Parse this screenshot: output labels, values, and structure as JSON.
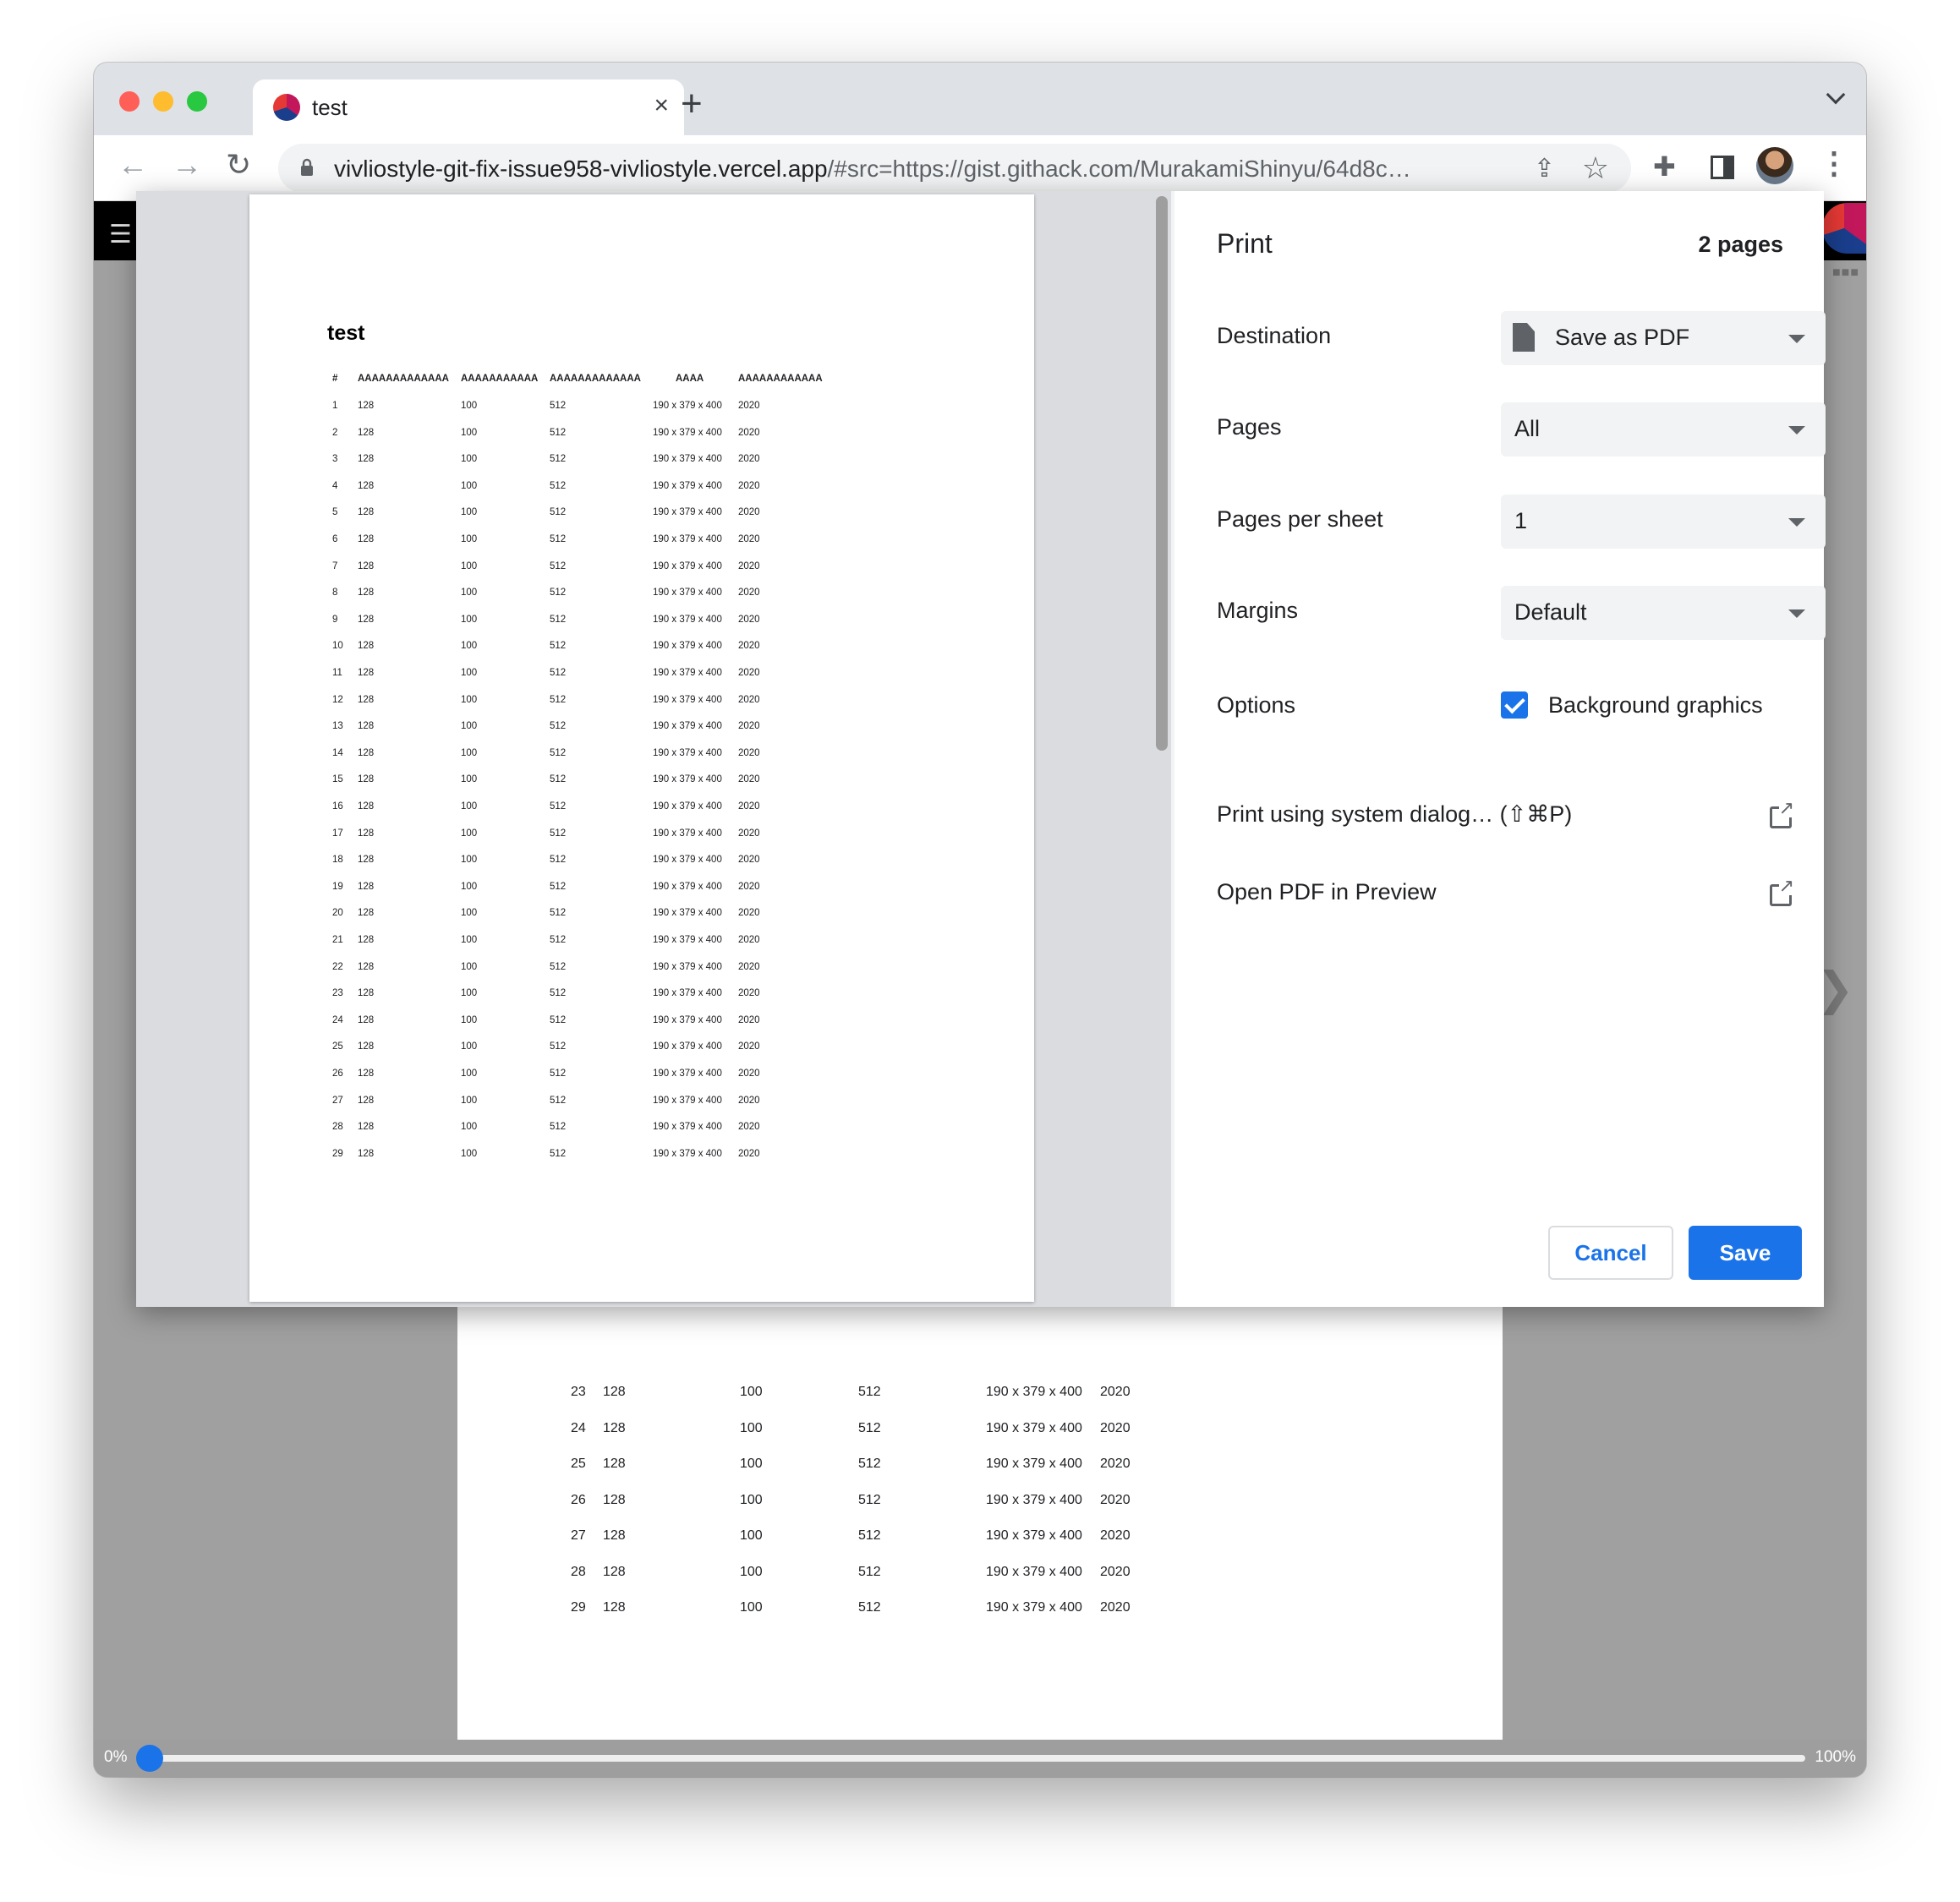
{
  "browser": {
    "tab_title": "test",
    "tab_close": "×",
    "new_tab": "+",
    "url_host": "vivliostyle-git-fix-issue958-vivliostyle.vercel.app",
    "url_rest": "/#src=https://gist.githack.com/MurakamiShinyu/64d8c…",
    "icons": [
      "back-arrow-icon",
      "forward-arrow-icon",
      "reload-icon",
      "lock-icon",
      "share-icon",
      "star-icon",
      "extensions-icon",
      "side-panel-icon",
      "avatar",
      "menu-icon"
    ]
  },
  "colors": {
    "accent": "#1a73e8",
    "close_light": "#ff5f57",
    "min_light": "#febc2e",
    "max_light": "#28c840"
  },
  "print_dialog": {
    "title": "Print",
    "page_count": "2 pages",
    "destination_label": "Destination",
    "destination_value": "Save as PDF",
    "pages_label": "Pages",
    "pages_value": "All",
    "pages_per_sheet_label": "Pages per sheet",
    "pages_per_sheet_value": "1",
    "margins_label": "Margins",
    "margins_value": "Default",
    "options_label": "Options",
    "background_graphics_label": "Background graphics",
    "background_graphics_checked": true,
    "system_dialog_label": "Print using system dialog… (⇧⌘P)",
    "open_pdf_label": "Open PDF in Preview",
    "cancel_label": "Cancel",
    "save_label": "Save"
  },
  "preview": {
    "doc_title": "test",
    "columns": [
      "#",
      "AAAAAAAAAAAAA",
      "AAAAAAAAAAA",
      "AAAAAAAAAAAAA",
      "AAAA",
      "AAAAAAAAAAAA"
    ],
    "row_values": [
      "128",
      "100",
      "512",
      "190 x 379 x 400",
      "2020"
    ],
    "row_count": 29
  },
  "background_page": {
    "row_numbers": [
      "23",
      "24",
      "25",
      "26",
      "27",
      "28",
      "29"
    ],
    "row_values": [
      "128",
      "100",
      "512",
      "190 x 379 x 400",
      "2020"
    ]
  },
  "progress": {
    "start_label": "0%",
    "end_label": "100%",
    "value": 0
  }
}
